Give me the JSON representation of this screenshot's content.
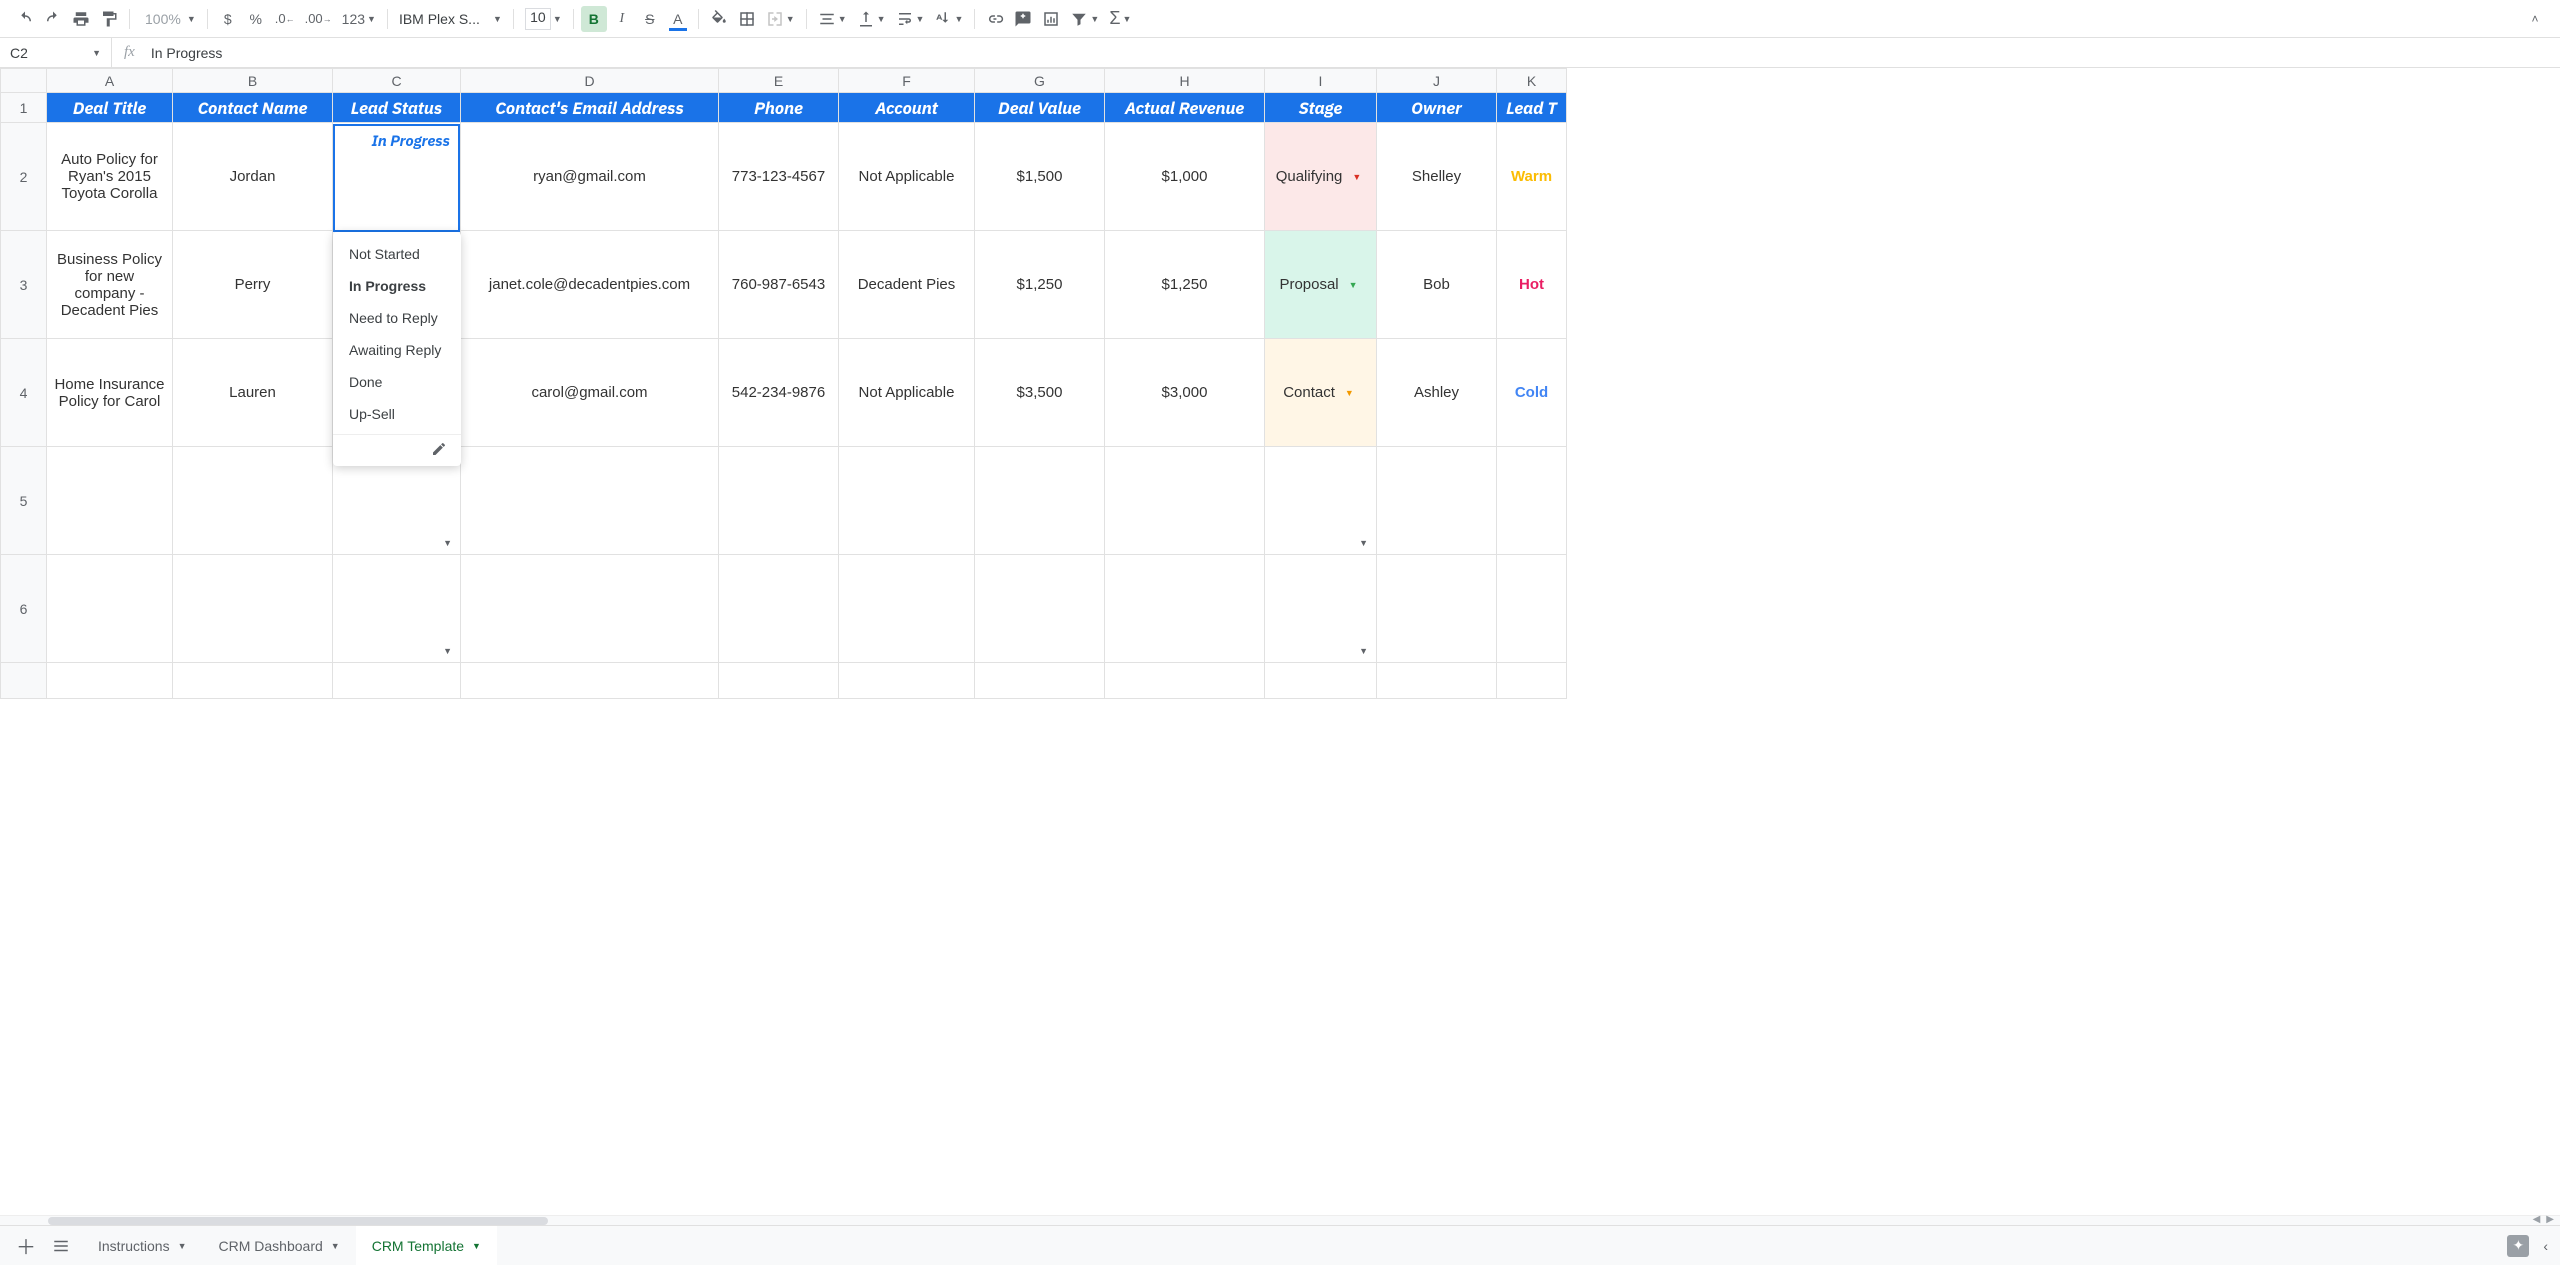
{
  "toolbar": {
    "zoom": "100%",
    "currency": "$",
    "percent": "%",
    "dec_dec": ".0",
    "dec_inc": ".00",
    "num_fmt": "123",
    "font_name": "IBM Plex S...",
    "font_size": "10",
    "bold": "B",
    "italic": "I",
    "strike": "S",
    "text_color": "A"
  },
  "name_box": "C2",
  "fx_label": "fx",
  "formula_bar": "In Progress",
  "columns": [
    "A",
    "B",
    "C",
    "D",
    "E",
    "F",
    "G",
    "H",
    "I",
    "J",
    "K"
  ],
  "row_nums": [
    "1",
    "2",
    "3",
    "4",
    "5",
    "6",
    ""
  ],
  "headers": [
    "Deal Title",
    "Contact Name",
    "Lead Status",
    "Contact's Email Address",
    "Phone",
    "Account",
    "Deal Value",
    "Actual Revenue",
    "Stage",
    "Owner",
    "Lead T"
  ],
  "rows": [
    {
      "deal": "Auto Policy for Ryan's 2015 Toyota Corolla",
      "contact": "Jordan",
      "status": "In Progress",
      "email": "ryan@gmail.com",
      "phone": "773-123-4567",
      "account": "Not Applicable",
      "value": "$1,500",
      "revenue": "$1,000",
      "stage": "Qualifying",
      "stage_class": "stage-qual",
      "stage_caret": "caret-red",
      "owner": "Shelley",
      "lead": "Warm",
      "lead_class": "lead-warm"
    },
    {
      "deal": "Business Policy for new company - Decadent Pies",
      "contact": "Perry",
      "status": "",
      "email": "janet.cole@decadentpies.com",
      "phone": "760-987-6543",
      "account": "Decadent Pies",
      "value": "$1,250",
      "revenue": "$1,250",
      "stage": "Proposal",
      "stage_class": "stage-prop",
      "stage_caret": "caret-green",
      "owner": "Bob",
      "lead": "Hot",
      "lead_class": "lead-hot"
    },
    {
      "deal": "Home Insurance Policy for Carol",
      "contact": "Lauren",
      "status": "",
      "email": "carol@gmail.com",
      "phone": "542-234-9876",
      "account": "Not Applicable",
      "value": "$3,500",
      "revenue": "$3,000",
      "stage": "Contact",
      "stage_class": "stage-cont",
      "stage_caret": "caret-orange",
      "owner": "Ashley",
      "lead": "Cold",
      "lead_class": "lead-cold"
    }
  ],
  "active_cell_value": "In Progress",
  "dropdown_options": [
    "Not Started",
    "In Progress",
    "Need to Reply",
    "Awaiting Reply",
    "Done",
    "Up-Sell"
  ],
  "tabs": [
    {
      "label": "Instructions",
      "active": false
    },
    {
      "label": "CRM Dashboard",
      "active": false
    },
    {
      "label": "CRM Template",
      "active": true
    }
  ]
}
